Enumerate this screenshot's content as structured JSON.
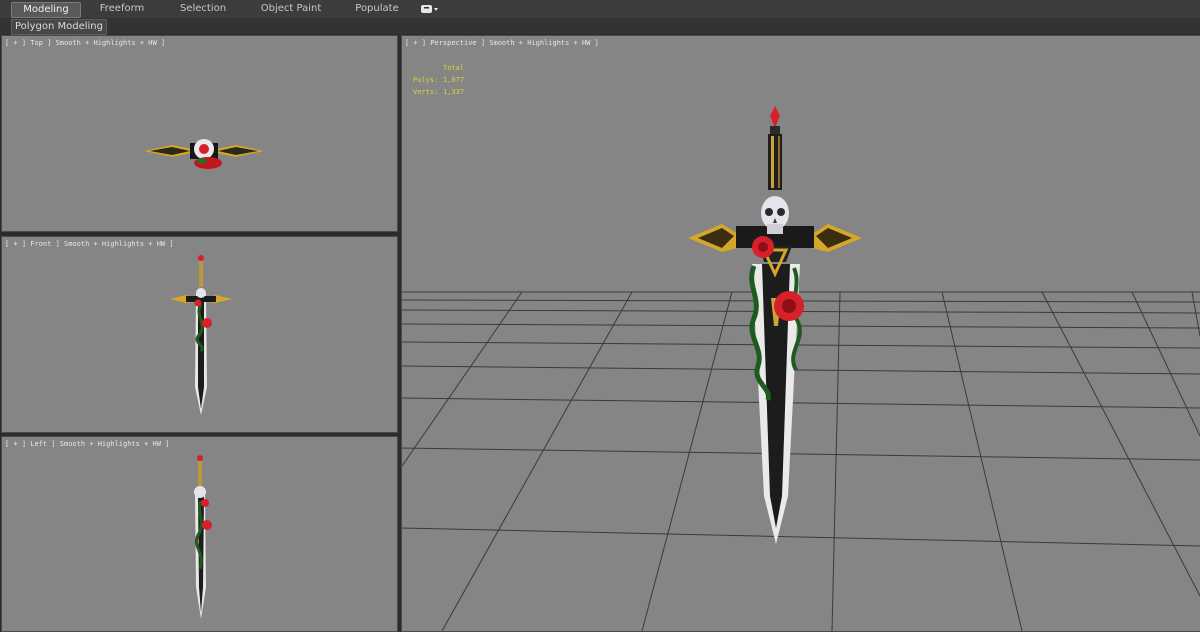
{
  "ribbon": {
    "tabs": [
      {
        "label": "Modeling",
        "active": true
      },
      {
        "label": "Freeform",
        "active": false
      },
      {
        "label": "Selection",
        "active": false
      },
      {
        "label": "Object Paint",
        "active": false
      },
      {
        "label": "Populate",
        "active": false
      }
    ],
    "panel_label": "Polygon Modeling"
  },
  "viewports": {
    "top": {
      "label": "[ + ] Top ] Smooth + Highlights + HW ]"
    },
    "front": {
      "label": "[ + ] Front ] Smooth + Highlights + HW ]"
    },
    "left": {
      "label": "[ + ] Left ] Smooth + Highlights + HW ]"
    },
    "perspective": {
      "label": "[ + ] Perspective ] Smooth + Highlights + HW ]"
    }
  },
  "stats": {
    "total_label": "Total",
    "polys_label": "Polys:",
    "polys_value": "1,077",
    "verts_label": "Verts:",
    "verts_value": "1,337"
  },
  "colors": {
    "viewport_bg": "#858585",
    "stats_text": "#d9d23a",
    "blade": "#1c1c1c",
    "blade_edge": "#e8e8e8",
    "gold": "#d4a62a",
    "rose": "#d8202a",
    "vine": "#1f5a1f",
    "skull": "#e4e4ea"
  }
}
